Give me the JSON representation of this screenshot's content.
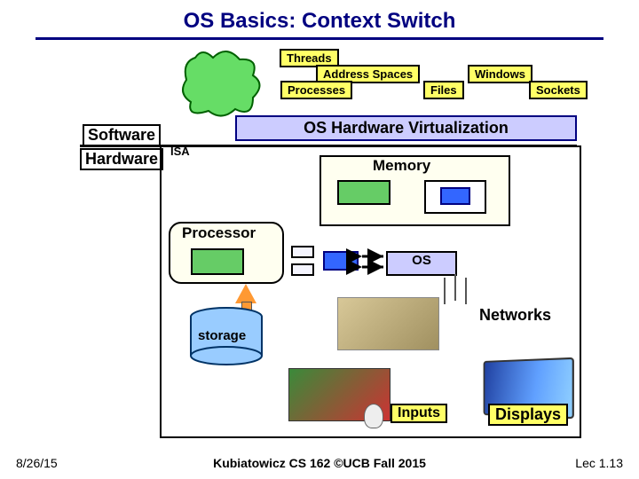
{
  "title": "OS Basics: Context Switch",
  "tags": {
    "threads": "Threads",
    "address_spaces": "Address Spaces",
    "windows": "Windows",
    "processes": "Processes",
    "files": "Files",
    "sockets": "Sockets"
  },
  "software_label": "Software",
  "oshv": "OS Hardware Virtualization",
  "hardware_label": "Hardware",
  "isa": "ISA",
  "memory": "Memory",
  "processor": "Processor",
  "os": "OS",
  "storage": "storage",
  "networks": "Networks",
  "inputs": "Inputs",
  "displays": "Displays",
  "footer": {
    "left": "8/26/15",
    "center": "Kubiatowicz CS 162 ©UCB Fall 2015",
    "right": "Lec 1.13"
  }
}
